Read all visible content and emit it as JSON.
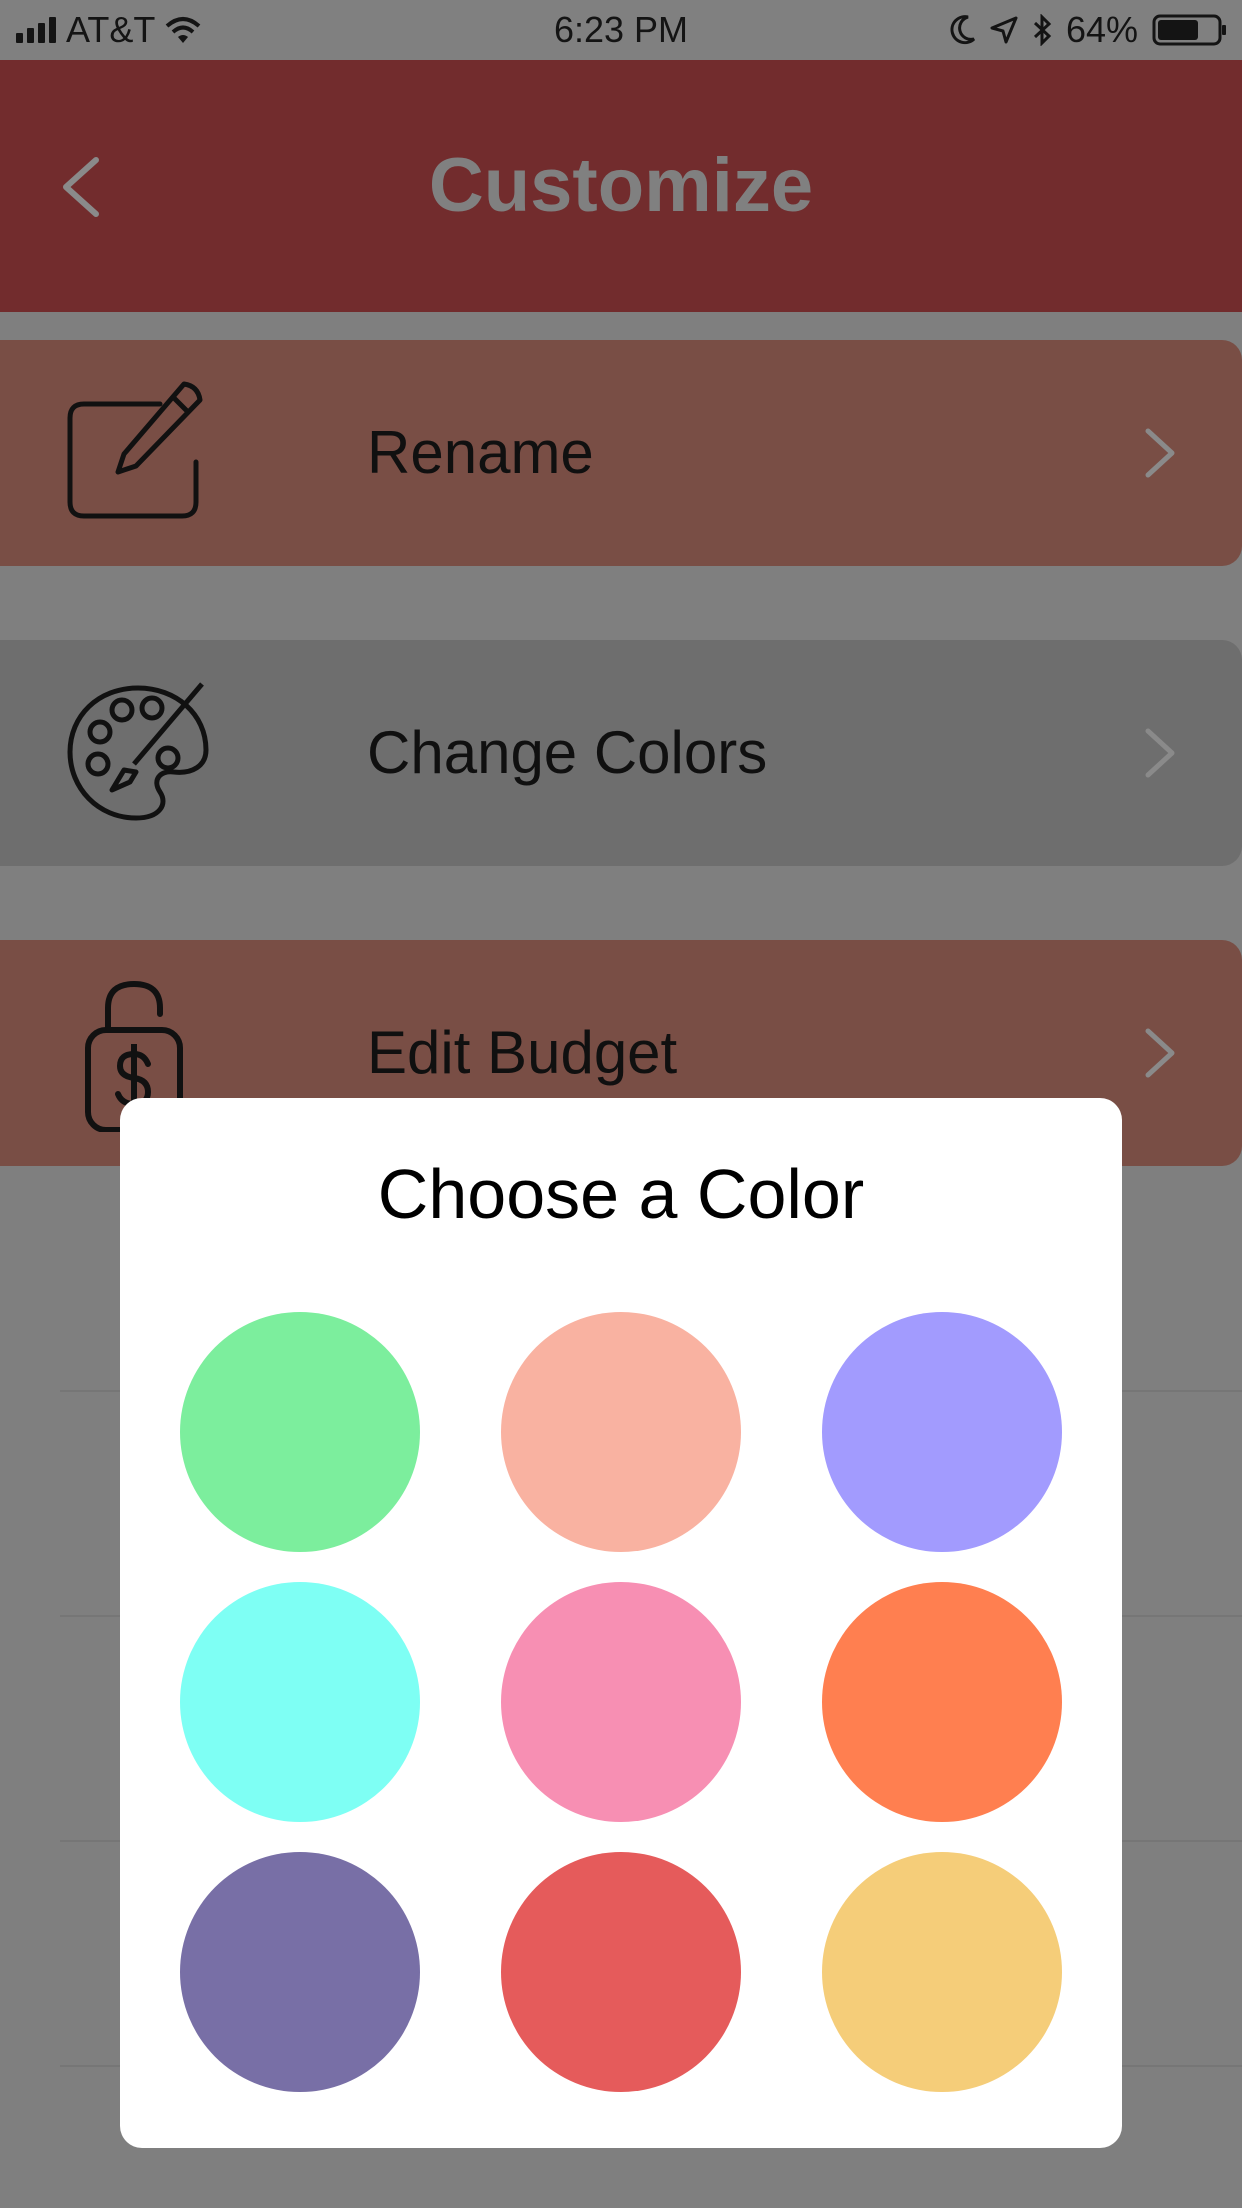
{
  "status_bar": {
    "carrier": "AT&T",
    "time": "6:23 PM",
    "battery": "64%",
    "icons": [
      "signal-icon",
      "wifi-icon",
      "moon-icon",
      "location-icon",
      "bluetooth-icon",
      "battery-icon"
    ]
  },
  "nav": {
    "title": "Customize",
    "back_icon": "chevron-left-icon"
  },
  "menu": {
    "rename": {
      "label": "Rename",
      "icon": "edit-icon"
    },
    "change_colors": {
      "label": "Change Colors",
      "icon": "palette-icon"
    },
    "edit_budget": {
      "label": "Edit Budget",
      "icon": "lock-dollar-icon"
    }
  },
  "modal": {
    "title": "Choose a Color",
    "colors": [
      "#7cee9d",
      "#f9b2a1",
      "#a29bfe",
      "#7efff4",
      "#f78fb3",
      "#ff7f50",
      "#786fa6",
      "#e55b5b",
      "#f5cd79"
    ]
  }
}
